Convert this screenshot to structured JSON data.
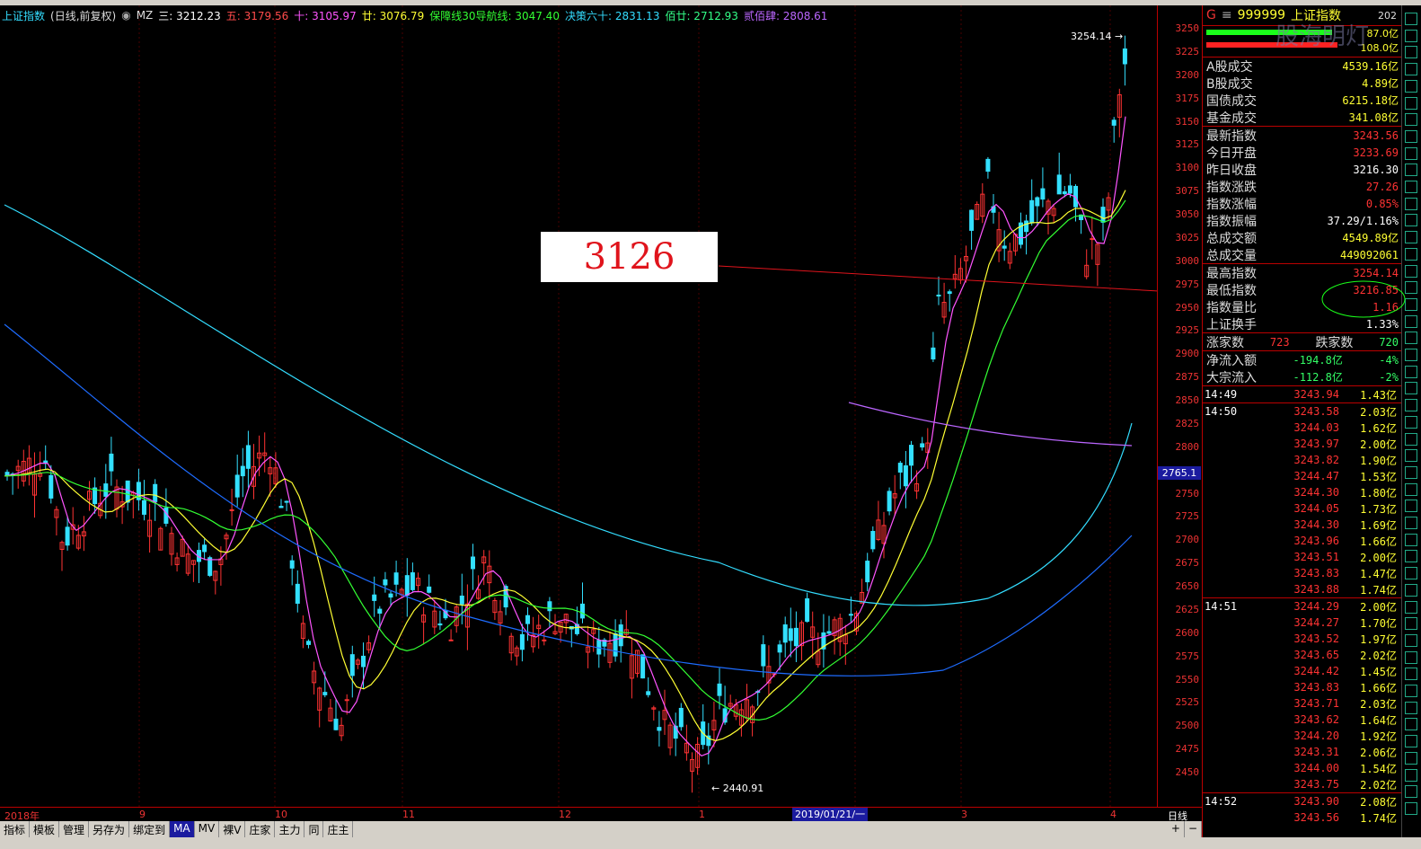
{
  "legend": {
    "title": "上证指数",
    "mode": "(日线,前复权)",
    "mz": "MZ",
    "items": [
      {
        "label": "三: 3212.23",
        "color": "#ffffff"
      },
      {
        "label": "五: 3179.56",
        "color": "#ff4b4b"
      },
      {
        "label": "十: 3105.97",
        "color": "#ff55ff"
      },
      {
        "label": "廿: 3076.79",
        "color": "#ffff33"
      },
      {
        "label": "保障线30导航线: 3047.40",
        "color": "#33ff33"
      },
      {
        "label": "决策六十: 2831.13",
        "color": "#33ddff"
      },
      {
        "label": "佰廿: 2712.93",
        "color": "#33ff88"
      },
      {
        "label": "贰佰肆: 2808.61",
        "color": "#bb66ff"
      }
    ]
  },
  "axis": {
    "ticks": [
      "3250",
      "3225",
      "3200",
      "3175",
      "3150",
      "3125",
      "3100",
      "3075",
      "3050",
      "3025",
      "3000",
      "2975",
      "2950",
      "2925",
      "2900",
      "2875",
      "2850",
      "2825",
      "2800",
      "2775",
      "2750",
      "2725",
      "2700",
      "2675",
      "2650",
      "2625",
      "2600",
      "2575",
      "2550",
      "2525",
      "2500",
      "2475",
      "2450"
    ],
    "current_tag": "2765.1"
  },
  "labels": {
    "high": "3254.14",
    "low": "2440.91",
    "annotation": "3126"
  },
  "dates": {
    "labels": [
      "2018年",
      "9",
      "10",
      "11",
      "12",
      "1",
      "3",
      "4"
    ],
    "marker": "2019/01/21/一",
    "period": "日线"
  },
  "tabs": [
    "指标",
    "模板",
    "管理",
    "另存为",
    "绑定到",
    "MA",
    "MV",
    "裸V",
    "庄家",
    "主力",
    "同",
    "庄主"
  ],
  "tab_plus": "+",
  "tab_minus": "−",
  "panel": {
    "code": "999999",
    "name": "上证指数",
    "extra": "202",
    "bar1": "87.0亿",
    "bar2": "108.0亿",
    "rows": [
      {
        "label": "A股成交",
        "value": "4539.16亿",
        "cls": "yellow"
      },
      {
        "label": "B股成交",
        "value": "4.89亿",
        "cls": "yellow"
      },
      {
        "label": "国债成交",
        "value": "6215.18亿",
        "cls": "yellow"
      },
      {
        "label": "基金成交",
        "value": "341.08亿",
        "cls": "yellow"
      },
      {
        "label": "最新指数",
        "value": "3243.56",
        "cls": "red"
      },
      {
        "label": "今日开盘",
        "value": "3233.69",
        "cls": "red"
      },
      {
        "label": "昨日收盘",
        "value": "3216.30",
        "cls": "white"
      },
      {
        "label": "指数涨跌",
        "value": "27.26",
        "cls": "red"
      },
      {
        "label": "指数涨幅",
        "value": "0.85%",
        "cls": "red"
      },
      {
        "label": "指数振幅",
        "value": "37.29/1.16%",
        "cls": "white"
      },
      {
        "label": "总成交额",
        "value": "4549.89亿",
        "cls": "yellow"
      },
      {
        "label": "总成交量",
        "value": "449092061",
        "cls": "yellow"
      },
      {
        "label": "最高指数",
        "value": "3254.14",
        "cls": "red"
      },
      {
        "label": "最低指数",
        "value": "3216.85",
        "cls": "red"
      },
      {
        "label": "指数量比",
        "value": "1.16",
        "cls": "red"
      },
      {
        "label": "上证换手",
        "value": "1.33%",
        "cls": "white"
      }
    ],
    "updown": {
      "up_label": "涨家数",
      "up": "723",
      "down_label": "跌家数",
      "down": "720"
    },
    "flows": [
      {
        "label": "净流入额",
        "value": "-194.8亿",
        "pct": "-4%"
      },
      {
        "label": "大宗流入",
        "value": "-112.8亿",
        "pct": "-2%"
      }
    ],
    "ticks": [
      {
        "t": "14:49",
        "p": "3243.94",
        "v": "1.43亿"
      },
      {
        "t": "14:50",
        "p": "3243.58",
        "v": "2.03亿"
      },
      {
        "t": "",
        "p": "3244.03",
        "v": "1.62亿"
      },
      {
        "t": "",
        "p": "3243.97",
        "v": "2.00亿"
      },
      {
        "t": "",
        "p": "3243.82",
        "v": "1.90亿"
      },
      {
        "t": "",
        "p": "3244.47",
        "v": "1.53亿"
      },
      {
        "t": "",
        "p": "3244.30",
        "v": "1.80亿"
      },
      {
        "t": "",
        "p": "3244.05",
        "v": "1.73亿"
      },
      {
        "t": "",
        "p": "3244.30",
        "v": "1.69亿"
      },
      {
        "t": "",
        "p": "3243.96",
        "v": "1.66亿"
      },
      {
        "t": "",
        "p": "3243.51",
        "v": "2.00亿"
      },
      {
        "t": "",
        "p": "3243.83",
        "v": "1.47亿"
      },
      {
        "t": "",
        "p": "3243.88",
        "v": "1.74亿"
      },
      {
        "t": "14:51",
        "p": "3244.29",
        "v": "2.00亿"
      },
      {
        "t": "",
        "p": "3244.27",
        "v": "1.70亿"
      },
      {
        "t": "",
        "p": "3243.52",
        "v": "1.97亿"
      },
      {
        "t": "",
        "p": "3243.65",
        "v": "2.02亿"
      },
      {
        "t": "",
        "p": "3244.42",
        "v": "1.45亿"
      },
      {
        "t": "",
        "p": "3243.83",
        "v": "1.66亿"
      },
      {
        "t": "",
        "p": "3243.71",
        "v": "2.03亿"
      },
      {
        "t": "",
        "p": "3243.62",
        "v": "1.64亿"
      },
      {
        "t": "",
        "p": "3244.20",
        "v": "1.92亿"
      },
      {
        "t": "",
        "p": "3243.31",
        "v": "2.06亿"
      },
      {
        "t": "",
        "p": "3244.00",
        "v": "1.54亿"
      },
      {
        "t": "",
        "p": "3243.75",
        "v": "2.02亿"
      },
      {
        "t": "14:52",
        "p": "3243.90",
        "v": "2.08亿"
      },
      {
        "t": "",
        "p": "3243.56",
        "v": "1.74亿"
      }
    ]
  },
  "watermark": "股海明灯"
}
